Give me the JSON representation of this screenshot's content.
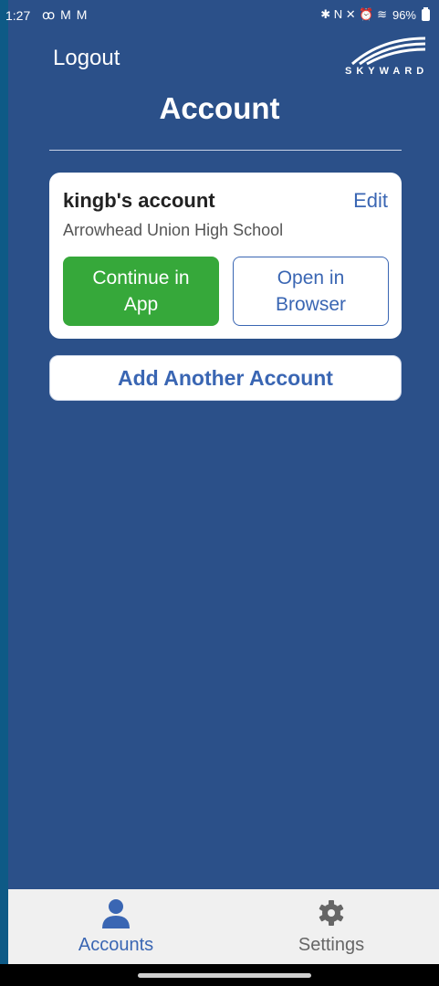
{
  "status_bar": {
    "time": "1:27",
    "left_icons": "ꝏ M M",
    "right_icons": "✱ N ✕ ⏰ ≋ ",
    "battery_percent": "96%"
  },
  "header": {
    "logout_label": "Logout",
    "logo_text": "SKYWARD",
    "title": "Account"
  },
  "account_card": {
    "name": "kingb's account",
    "edit_label": "Edit",
    "school": "Arrowhead Union High School",
    "continue_label": "Continue in App",
    "browser_label": "Open in Browser"
  },
  "add_account_label": "Add Another Account",
  "tabs": [
    {
      "label": "Accounts",
      "icon": "person-icon",
      "active": true
    },
    {
      "label": "Settings",
      "icon": "gear-icon",
      "active": false
    }
  ],
  "colors": {
    "background": "#2b5089",
    "accent": "#3a66b3",
    "continue_green": "#36a83a"
  }
}
